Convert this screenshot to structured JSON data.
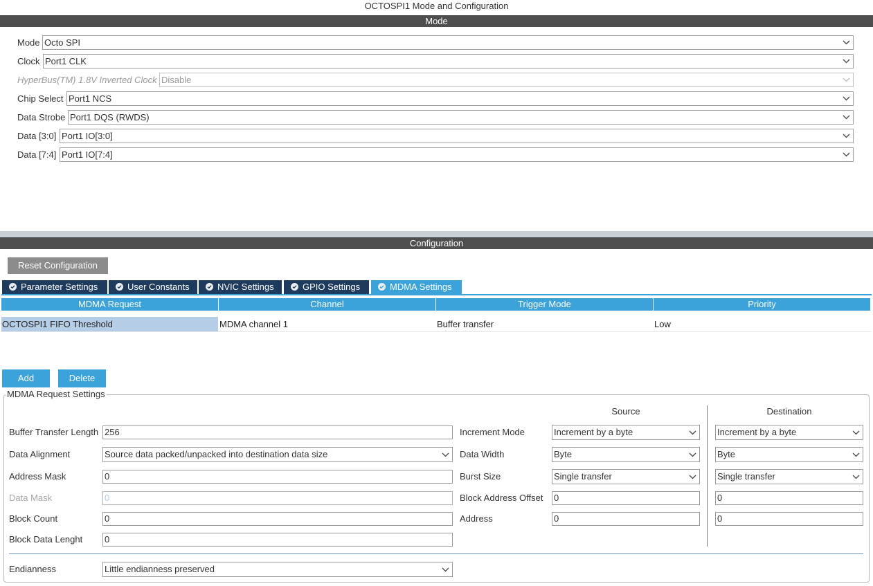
{
  "window_title": "OCTOSPI1 Mode and Configuration",
  "mode_section": {
    "title": "Mode",
    "rows": [
      {
        "label": "Mode",
        "value": "Octo SPI",
        "disabled": false
      },
      {
        "label": "Clock",
        "value": "Port1 CLK",
        "disabled": false
      },
      {
        "label": "HyperBus(TM) 1.8V Inverted Clock",
        "value": "Disable",
        "disabled": true
      },
      {
        "label": "Chip Select",
        "value": "Port1 NCS",
        "disabled": false
      },
      {
        "label": "Data Strobe",
        "value": "Port1 DQS (RWDS)",
        "disabled": false
      },
      {
        "label": "Data [3:0]",
        "value": "Port1 IO[3:0]",
        "disabled": false
      },
      {
        "label": "Data [7:4]",
        "value": "Port1 IO[7:4]",
        "disabled": false
      }
    ]
  },
  "config_section": {
    "title": "Configuration",
    "reset_button": "Reset Configuration",
    "tabs": [
      {
        "label": "Parameter Settings",
        "active": false
      },
      {
        "label": "User Constants",
        "active": false
      },
      {
        "label": "NVIC Settings",
        "active": false
      },
      {
        "label": "GPIO Settings",
        "active": false
      },
      {
        "label": "MDMA Settings",
        "active": true
      }
    ],
    "table": {
      "headers": [
        "MDMA Request",
        "Channel",
        "Trigger Mode",
        "Priority"
      ],
      "rows": [
        [
          "OCTOSPI1 FIFO Threshold",
          "MDMA channel 1",
          "Buffer transfer",
          "Low"
        ]
      ]
    },
    "add_button": "Add",
    "delete_button": "Delete"
  },
  "request_settings": {
    "legend": "MDMA Request Settings",
    "source_header": "Source",
    "destination_header": "Destination",
    "left_fields": {
      "buffer_transfer_length": {
        "label": "Buffer Transfer Length",
        "value": "256"
      },
      "data_alignment": {
        "label": "Data Alignment",
        "value": "Source data packed/unpacked into destination data size"
      },
      "address_mask": {
        "label": "Address Mask",
        "value": "0"
      },
      "data_mask": {
        "label": "Data Mask",
        "value": "0"
      },
      "block_count": {
        "label": "Block Count",
        "value": "0"
      },
      "block_data_length": {
        "label": "Block Data Lenght",
        "value": "0"
      },
      "endianness": {
        "label": "Endianness",
        "value": "Little endianness preserved"
      }
    },
    "right_fields": {
      "increment_mode": {
        "label": "Increment Mode",
        "source": "Increment by a byte",
        "destination": "Increment by a byte"
      },
      "data_width": {
        "label": "Data Width",
        "source": "Byte",
        "destination": "Byte"
      },
      "burst_size": {
        "label": "Burst Size",
        "source": "Single transfer",
        "destination": "Single transfer"
      },
      "block_address_offset": {
        "label": "Block Address Offset",
        "source": "0",
        "destination": "0"
      },
      "address": {
        "label": "Address",
        "source": "0",
        "destination": "0"
      }
    }
  },
  "colors": {
    "accent": "#3ba3da",
    "tab_dark": "#1e3a5c",
    "section_bar": "#4e4e4e",
    "selected_row": "#b5cde6"
  },
  "icons": {
    "dropdown": "chevron-down-icon",
    "tab_status": "check-circle-icon"
  }
}
